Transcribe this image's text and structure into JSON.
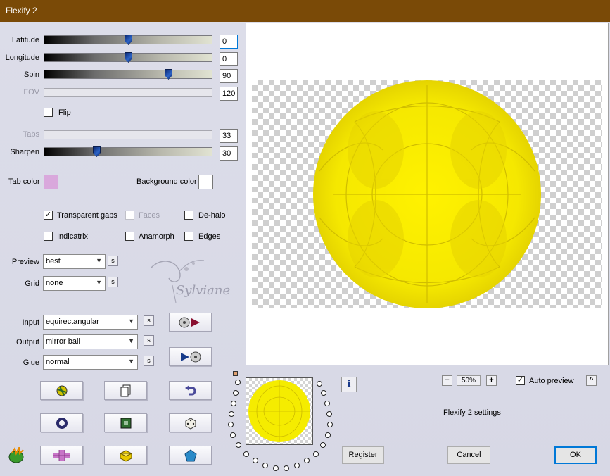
{
  "window": {
    "title": "Flexify 2"
  },
  "sliders": {
    "latitude": {
      "label": "Latitude",
      "value": "0"
    },
    "longitude": {
      "label": "Longitude",
      "value": "0"
    },
    "spin": {
      "label": "Spin",
      "value": "90"
    },
    "fov": {
      "label": "FOV",
      "value": "120"
    },
    "tabs": {
      "label": "Tabs",
      "value": "33"
    },
    "sharpen": {
      "label": "Sharpen",
      "value": "30"
    }
  },
  "flip": {
    "label": "Flip",
    "checked": false
  },
  "colors": {
    "tab_color_label": "Tab color",
    "tab_color": "#d9a8dc",
    "background_color_label": "Background color",
    "background_color": "#ffffff"
  },
  "options": {
    "transparent_gaps": {
      "label": "Transparent gaps",
      "checked": true,
      "mark": "✓"
    },
    "faces": {
      "label": "Faces",
      "checked": false
    },
    "de_halo": {
      "label": "De-halo",
      "checked": false
    },
    "indicatrix": {
      "label": "Indicatrix",
      "checked": false
    },
    "anamorph": {
      "label": "Anamorph",
      "checked": false
    },
    "edges": {
      "label": "Edges",
      "checked": false
    }
  },
  "selects": {
    "preview": {
      "label": "Preview",
      "value": "best"
    },
    "grid": {
      "label": "Grid",
      "value": "none"
    },
    "input": {
      "label": "Input",
      "value": "equirectangular"
    },
    "output": {
      "label": "Output",
      "value": "mirror ball"
    },
    "glue": {
      "label": "Glue",
      "value": "normal"
    },
    "s_label": "s"
  },
  "watermark": {
    "text": "Sylviane"
  },
  "zoom": {
    "minus": "−",
    "value": "50%",
    "plus": "+"
  },
  "auto_preview": {
    "label": "Auto preview",
    "checked": true,
    "mark": "✓",
    "collapse": "^"
  },
  "info_icon": "i",
  "settings_name": "Flexify 2 settings",
  "buttons": {
    "register": "Register",
    "cancel": "Cancel",
    "ok": "OK"
  },
  "accent": {
    "title_bar": "#7a4a07",
    "ball_yellow": "#f5ef00",
    "focus_blue": "#0078d7"
  }
}
